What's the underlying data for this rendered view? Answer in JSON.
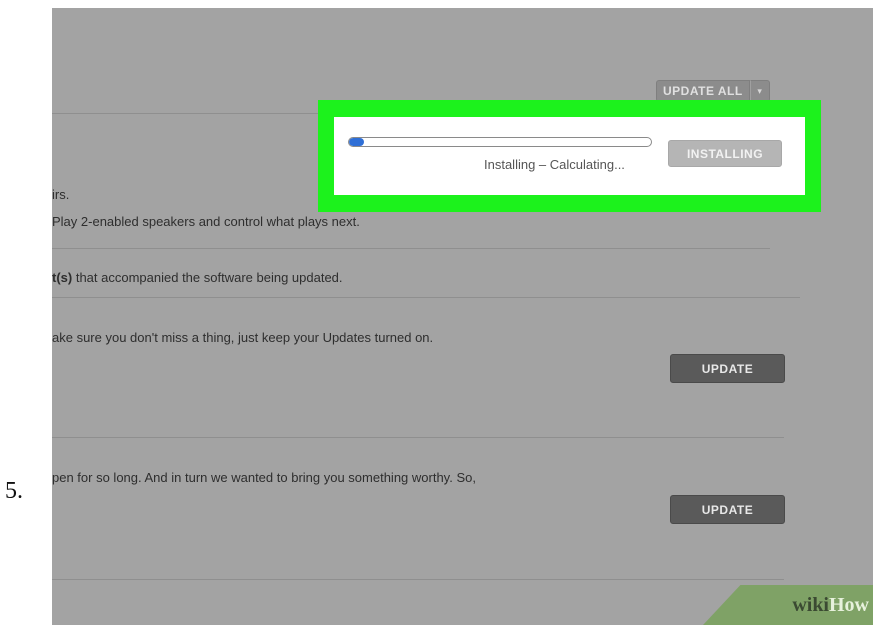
{
  "step_number": "5.",
  "toolbar": {
    "update_all_label": "UPDATE ALL",
    "update_all_caret": "▾"
  },
  "install_panel": {
    "progress_fraction": 0.05,
    "status_text": "Installing – Calculating...",
    "installing_label": "INSTALLING"
  },
  "updates": [
    {
      "line1": "irs.",
      "line2": "Play 2-enabled speakers and control what plays next."
    },
    {
      "bold_prefix": "t(s)",
      "text": " that accompanied the software being updated."
    },
    {
      "text": "ake sure you don't miss a thing, just keep your Updates turned on.",
      "button_label": "UPDATE"
    },
    {
      "text": "pen for so long. And in turn we wanted to bring you something worthy. So,",
      "button_label": "UPDATE"
    }
  ],
  "watermark": {
    "wiki": "wiki",
    "how": "How"
  },
  "colors": {
    "highlight": "#1cf21c",
    "progress": "#2f6fd6",
    "screen_overlay": "#a3a3a3"
  }
}
